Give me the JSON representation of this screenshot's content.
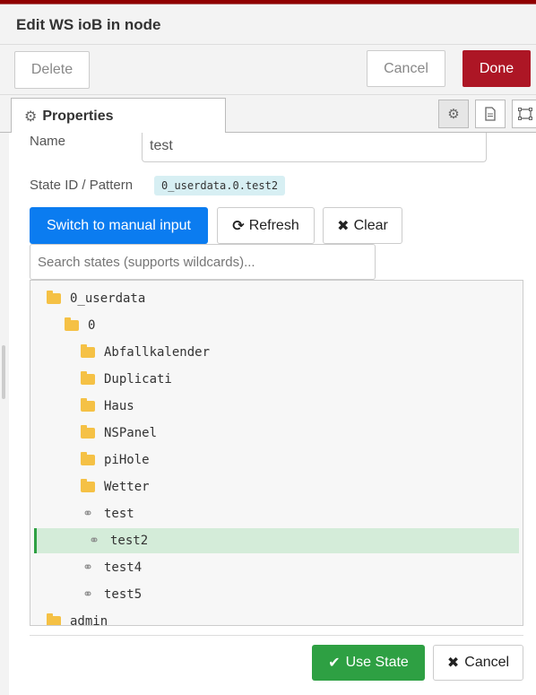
{
  "dialog": {
    "title": "Edit WS ioB in node"
  },
  "actions": {
    "delete_label": "Delete",
    "cancel_label": "Cancel",
    "done_label": "Done"
  },
  "tabs": {
    "properties_label": "Properties"
  },
  "form": {
    "name_label": "Name",
    "name_value": "test",
    "state_id_label": "State ID / Pattern",
    "state_id_value": "0_userdata.0.test2"
  },
  "selector": {
    "manual_input_label": "Switch to manual input",
    "refresh_label": "Refresh",
    "clear_label": "Clear",
    "search_placeholder": "Search states (supports wildcards)..."
  },
  "tree": {
    "items": [
      {
        "label": "0_userdata",
        "type": "folder",
        "level": 0
      },
      {
        "label": "0",
        "type": "folder",
        "level": 1
      },
      {
        "label": "Abfallkalender",
        "type": "folder",
        "level": 2
      },
      {
        "label": "Duplicati",
        "type": "folder",
        "level": 2
      },
      {
        "label": "Haus",
        "type": "folder",
        "level": 2
      },
      {
        "label": "NSPanel",
        "type": "folder",
        "level": 2
      },
      {
        "label": "piHole",
        "type": "folder",
        "level": 2
      },
      {
        "label": "Wetter",
        "type": "folder",
        "level": 2
      },
      {
        "label": "test",
        "type": "state",
        "level": 2
      },
      {
        "label": "test2",
        "type": "state",
        "level": 2,
        "selected": true
      },
      {
        "label": "test4",
        "type": "state",
        "level": 2
      },
      {
        "label": "test5",
        "type": "state",
        "level": 2
      },
      {
        "label": "admin",
        "type": "folder",
        "level": 0
      }
    ]
  },
  "footer": {
    "use_state_label": "Use State",
    "cancel_label": "Cancel"
  },
  "colors": {
    "done": "#ad1625",
    "primary": "#0b7cf0",
    "success": "#2ea043",
    "selected_row": "#d4ecd9",
    "folder": "#f5c145",
    "code_bg": "#d7eff3"
  }
}
